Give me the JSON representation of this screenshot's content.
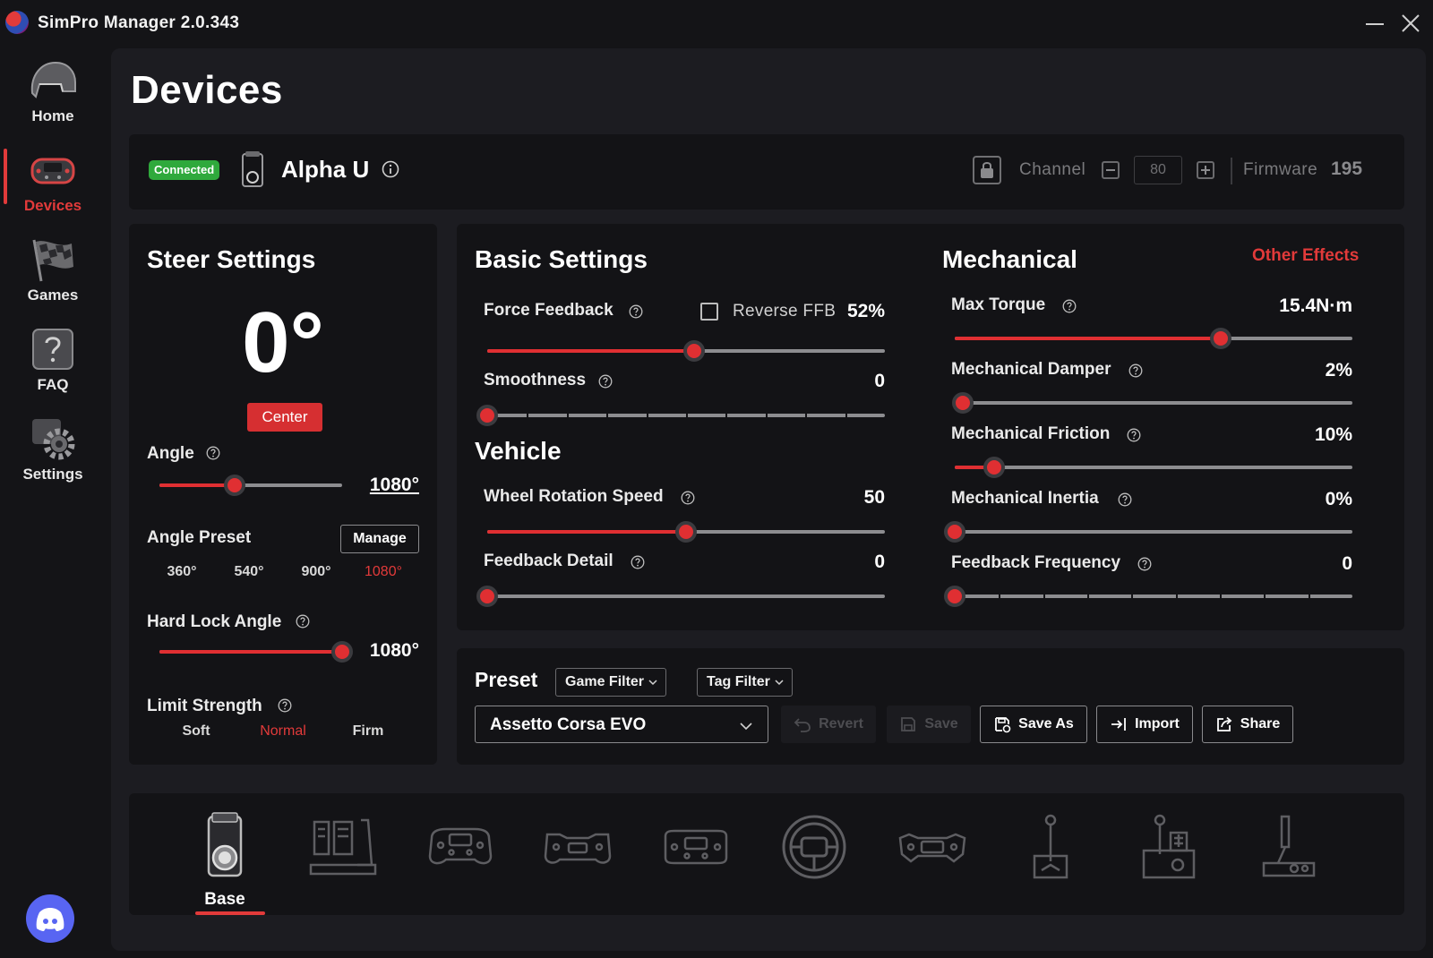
{
  "window": {
    "title": "SimPro Manager 2.0.343"
  },
  "sidebar": {
    "items": [
      {
        "label": "Home",
        "icon": "helmet-icon"
      },
      {
        "label": "Devices",
        "icon": "steering-wheel-icon",
        "active": true
      },
      {
        "label": "Games",
        "icon": "checkered-flag-icon"
      },
      {
        "label": "FAQ",
        "icon": "question-icon"
      },
      {
        "label": "Settings",
        "icon": "gear-icon"
      }
    ],
    "discord_icon": "discord-icon"
  },
  "page": {
    "title": "Devices"
  },
  "device": {
    "status": "Connected",
    "name": "Alpha U",
    "channel_label": "Channel",
    "channel_value": "80",
    "firmware_label": "Firmware",
    "firmware_value": "195"
  },
  "steer": {
    "title": "Steer Settings",
    "current_angle": "0°",
    "center_label": "Center",
    "angle_label": "Angle",
    "angle_value": "1080°",
    "angle_fraction": 0.41,
    "preset_label": "Angle Preset",
    "manage_label": "Manage",
    "presets": [
      "360°",
      "540°",
      "900°",
      "1080°"
    ],
    "preset_selected": "1080°",
    "hardlock_label": "Hard Lock Angle",
    "hardlock_value": "1080°",
    "hardlock_fraction": 1.0,
    "limit_label": "Limit Strength",
    "limit_options": [
      "Soft",
      "Normal",
      "Firm"
    ],
    "limit_selected": "Normal"
  },
  "basic": {
    "title": "Basic Settings",
    "force_feedback": {
      "label": "Force Feedback",
      "value": "52%",
      "fraction": 0.52
    },
    "reverse_ffb_label": "Reverse FFB",
    "reverse_ffb_checked": false,
    "smoothness": {
      "label": "Smoothness",
      "value": "0",
      "fraction": 0
    }
  },
  "vehicle": {
    "title": "Vehicle",
    "wheel_rotation_speed": {
      "label": "Wheel Rotation Speed",
      "value": "50",
      "fraction": 0.5
    },
    "feedback_detail": {
      "label": "Feedback Detail",
      "value": "0",
      "fraction": 0
    }
  },
  "mechanical": {
    "title": "Mechanical",
    "other_effects_label": "Other Effects",
    "max_torque": {
      "label": "Max Torque",
      "value": "15.4N·m",
      "fraction": 0.67
    },
    "damper": {
      "label": "Mechanical Damper",
      "value": "2%",
      "fraction": 0.02
    },
    "friction": {
      "label": "Mechanical Friction",
      "value": "10%",
      "fraction": 0.1
    },
    "inertia": {
      "label": "Mechanical Inertia",
      "value": "0%",
      "fraction": 0
    },
    "feedback_frequency": {
      "label": "Feedback Frequency",
      "value": "0",
      "fraction": 0
    }
  },
  "preset": {
    "title": "Preset",
    "game_filter_label": "Game Filter",
    "tag_filter_label": "Tag Filter",
    "selected": "Assetto Corsa EVO",
    "revert_label": "Revert",
    "save_label": "Save",
    "save_as_label": "Save As",
    "import_label": "Import",
    "share_label": "Share"
  },
  "device_types": [
    {
      "label": "Base",
      "icon": "wheel-base-icon",
      "active": true
    },
    {
      "label": "",
      "icon": "pedals-icon"
    },
    {
      "label": "",
      "icon": "formula-wheel-icon"
    },
    {
      "label": "",
      "icon": "gt-wheel-icon"
    },
    {
      "label": "",
      "icon": "butterfly-wheel-icon"
    },
    {
      "label": "",
      "icon": "round-wheel-icon"
    },
    {
      "label": "",
      "icon": "yoke-wheel-icon"
    },
    {
      "label": "",
      "icon": "sequential-shifter-icon"
    },
    {
      "label": "",
      "icon": "h-shifter-icon"
    },
    {
      "label": "",
      "icon": "handbrake-icon"
    }
  ],
  "colors": {
    "accent": "#e23a3a",
    "connected": "#2fa93c",
    "panel": "#131316",
    "background": "#1c1c21"
  }
}
